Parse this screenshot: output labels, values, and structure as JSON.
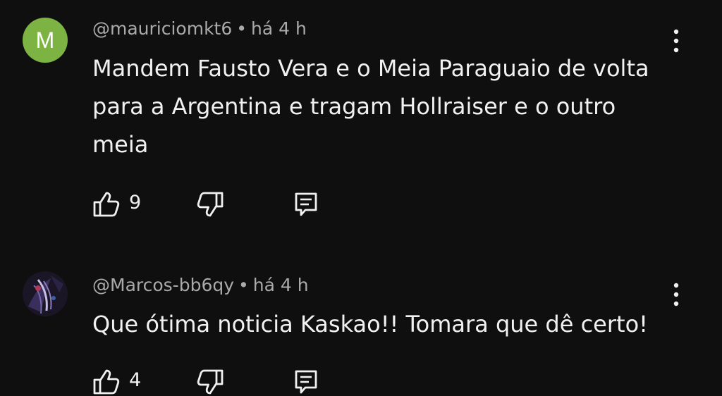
{
  "comments": [
    {
      "avatar_letter": "M",
      "avatar_color": "#7cb342",
      "author": "@mauriciomkt6",
      "separator": "•",
      "time": "há 4 h",
      "text": "Mandem Fausto Vera e o Meia Paraguaio de volta para a Argentina e tragam Hollraiser e o outro meia",
      "likes": "9",
      "icons": [
        "thumbs-up-icon",
        "thumbs-down-icon",
        "reply-icon",
        "more-vert-icon"
      ]
    },
    {
      "avatar_letter": "",
      "author": "@Marcos-bb6qy",
      "separator": "•",
      "time": "há 4 h",
      "text": "Que ótima noticia Kaskao!! Tomara que dê certo!",
      "likes": "4",
      "icons": [
        "thumbs-up-icon",
        "thumbs-down-icon",
        "reply-icon",
        "more-vert-icon"
      ]
    }
  ],
  "colors": {
    "background": "#0f0f0f",
    "primary_text": "#f1f1f1",
    "secondary_text": "#aaaaaa"
  }
}
